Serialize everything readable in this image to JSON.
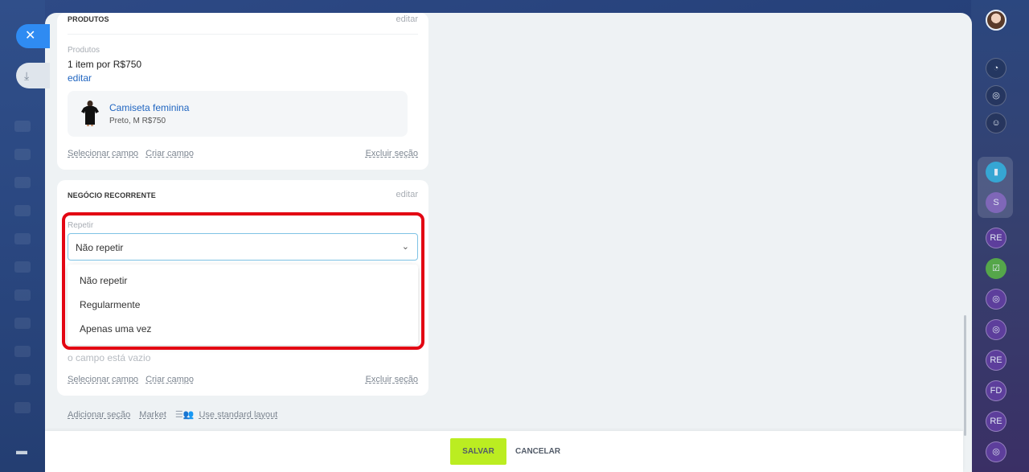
{
  "products_section": {
    "title": "PRODUTOS",
    "edit_label": "editar",
    "field_label": "Produtos",
    "summary": "1 item por R$750",
    "summary_edit": "editar",
    "product": {
      "name": "Camiseta feminina",
      "details": "Preto, M  R$750"
    },
    "select_field": "Selecionar campo",
    "create_field": "Criar campo",
    "delete_section": "Excluir seção"
  },
  "recurring_section": {
    "title": "NEGÓCIO RECORRENTE",
    "edit_label": "editar",
    "field_label": "Repetir",
    "selected_value": "Não repetir",
    "options": [
      "Não repetir",
      "Regularmente",
      "Apenas uma vez"
    ],
    "empty_text": "o campo está vazio",
    "select_field": "Selecionar campo",
    "create_field": "Criar campo",
    "delete_section": "Excluir seção"
  },
  "page_links": {
    "add_section": "Adicionar seção",
    "market": "Market",
    "standard_layout": "Use standard layout"
  },
  "footer": {
    "save": "SALVAR",
    "cancel": "CANCELAR"
  },
  "right_sidebar": {
    "labels": [
      "S",
      "RE",
      "RE",
      "FD",
      "RE"
    ]
  },
  "colors": {
    "save_button": "#bbed21",
    "highlight": "#e30613",
    "link": "#2166c1",
    "close_button": "#2f8bf2"
  },
  "icons": [
    "close-icon",
    "collapse-icon",
    "print-icon",
    "bell-icon",
    "chevron-down-icon",
    "layout-users-icon"
  ]
}
